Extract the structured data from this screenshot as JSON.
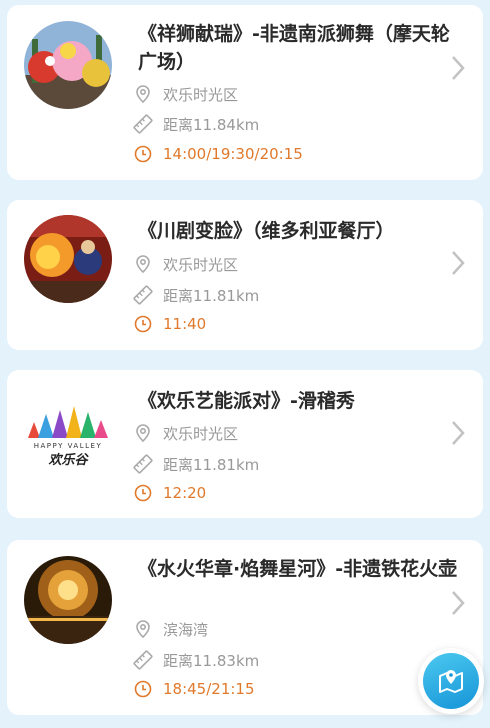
{
  "events": [
    {
      "title": "《祥狮献瑞》-非遗南派狮舞（摩天轮广场）",
      "location": "欢乐时光区",
      "distance": "距离11.84km",
      "time": "14:00/19:30/20:15",
      "image": "lion-dance-photo"
    },
    {
      "title": "《川剧变脸》（维多利亚餐厅）",
      "location": "欢乐时光区",
      "distance": "距离11.81km",
      "time": "11:40",
      "image": "sichuan-opera-photo"
    },
    {
      "title": "《欢乐艺能派对》-滑稽秀",
      "location": "欢乐时光区",
      "distance": "距离11.81km",
      "time": "12:20",
      "image": "happy-valley-logo",
      "logo_text": "欢乐谷",
      "logo_sub": "HAPPY VALLEY"
    },
    {
      "title": "《水火华章·焰舞星河》-非遗铁花火壶",
      "location": "滨海湾",
      "distance": "距离11.83km",
      "time": "18:45/21:15",
      "image": "fireworks-photo"
    }
  ],
  "fab": {
    "icon": "map-pin-icon"
  },
  "colors": {
    "accent_orange": "#e0792b",
    "muted_gray": "#999999",
    "fab_blue": "#1594d8"
  }
}
